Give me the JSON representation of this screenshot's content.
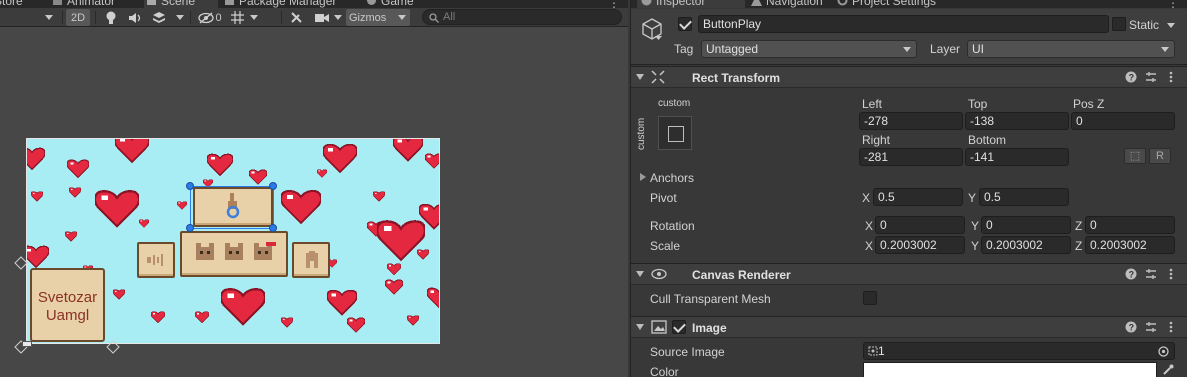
{
  "scene_panel": {
    "tabs": [
      {
        "label": "Store",
        "icon": "store-icon",
        "active": false
      },
      {
        "label": "Animator",
        "icon": "animator-icon",
        "active": false
      },
      {
        "label": "Scene",
        "icon": "scene-icon",
        "active": true
      },
      {
        "label": "Package Manager",
        "icon": "package-icon",
        "active": false
      },
      {
        "label": "Game",
        "icon": "game-icon",
        "active": false
      }
    ],
    "toolbar": {
      "mode_2d": "2D",
      "hidden_count": "0",
      "gizmos_label": "Gizmos",
      "search_placeholder": "All"
    },
    "canvas": {
      "background_color": "#a8edf3",
      "signature_line1": "Svetozar",
      "signature_line2": "Uamgl"
    }
  },
  "inspector": {
    "tabs": [
      {
        "label": "Inspector",
        "icon": "info-icon",
        "active": true
      },
      {
        "label": "Navigation",
        "icon": "navigation-icon",
        "active": false
      },
      {
        "label": "Project Settings",
        "icon": "gear-icon",
        "active": false
      }
    ],
    "object": {
      "active": true,
      "name": "ButtonPlay",
      "static_label": "Static",
      "static": false,
      "tag_label": "Tag",
      "tag_value": "Untagged",
      "layer_label": "Layer",
      "layer_value": "UI"
    },
    "rect_transform": {
      "title": "Rect Transform",
      "anchor_preset_top": "custom",
      "anchor_preset_side": "custom",
      "left_label": "Left",
      "left_value": "-278",
      "top_label": "Top",
      "top_value": "-138",
      "posz_label": "Pos Z",
      "posz_value": "0",
      "right_label": "Right",
      "right_value": "-281",
      "bottom_label": "Bottom",
      "bottom_value": "-141",
      "raw_button": "R",
      "anchors_label": "Anchors",
      "pivot_label": "Pivot",
      "pivot_x": "0.5",
      "pivot_y": "0.5",
      "rotation_label": "Rotation",
      "rotation_x": "0",
      "rotation_y": "0",
      "rotation_z": "0",
      "scale_label": "Scale",
      "scale_x": "0.2003002",
      "scale_y": "0.2003002",
      "scale_z": "0.2003002",
      "axis_x": "X",
      "axis_y": "Y",
      "axis_z": "Z"
    },
    "canvas_renderer": {
      "title": "Canvas Renderer",
      "cull_label": "Cull Transparent Mesh",
      "cull_value": false
    },
    "image": {
      "title": "Image",
      "enabled": true,
      "source_label": "Source Image",
      "source_value": "1",
      "color_label": "Color",
      "color_value": "#ffffff"
    }
  },
  "colors": {
    "heart_red": "#e3283f",
    "heart_dark": "#8c1426",
    "selection_blue": "#2b7be8",
    "panel_tan": "#e8d0a8",
    "panel_border": "#6b4a2b"
  }
}
